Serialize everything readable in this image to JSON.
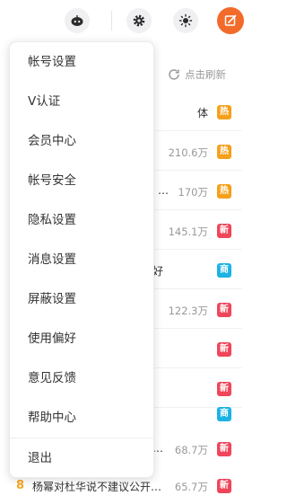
{
  "topbar": {
    "icons": [
      "robot-icon",
      "settings-icon",
      "theme-sun-icon",
      "edit-icon"
    ],
    "colors": {
      "edit": "#f26b2a",
      "iconBg": "#f0f0f2"
    }
  },
  "panel": {
    "refresh_label": "点击刷新",
    "rows": [
      {
        "text": "体",
        "count": "",
        "badge": "热",
        "badge_color": "#f5a01a"
      },
      {
        "text": "",
        "count": "210.6万",
        "badge": "热",
        "badge_color": "#f5a01a"
      },
      {
        "text": "…",
        "count": "170万",
        "badge": "热",
        "badge_color": "#f5a01a"
      },
      {
        "text": "",
        "count": "145.1万",
        "badge": "新",
        "badge_color": "#f0455a"
      },
      {
        "text": "好",
        "count": "",
        "badge": "商",
        "badge_color": "#1bb3e4"
      },
      {
        "text": "",
        "count": "122.3万",
        "badge": "新",
        "badge_color": "#f0455a"
      },
      {
        "text": "",
        "count": "",
        "badge": "新",
        "badge_color": "#f0455a"
      },
      {
        "text": "",
        "count": "",
        "badge": "新",
        "badge_color": "#f0455a"
      },
      {
        "text": "",
        "count": "",
        "badge": "商",
        "badge_color": "#1bb3e4"
      },
      {
        "text": "…",
        "count": "68.7万",
        "badge": "新",
        "badge_color": "#f0455a"
      }
    ],
    "last_row": {
      "rank": "8",
      "title": "杨幂对杜华说不建议公开…",
      "count": "65.7万",
      "badge": "新",
      "badge_color": "#f0455a"
    }
  },
  "menu": {
    "items": [
      "帐号设置",
      "V认证",
      "会员中心",
      "帐号安全",
      "隐私设置",
      "消息设置",
      "屏蔽设置",
      "使用偏好",
      "意见反馈",
      "帮助中心",
      "退出"
    ]
  }
}
